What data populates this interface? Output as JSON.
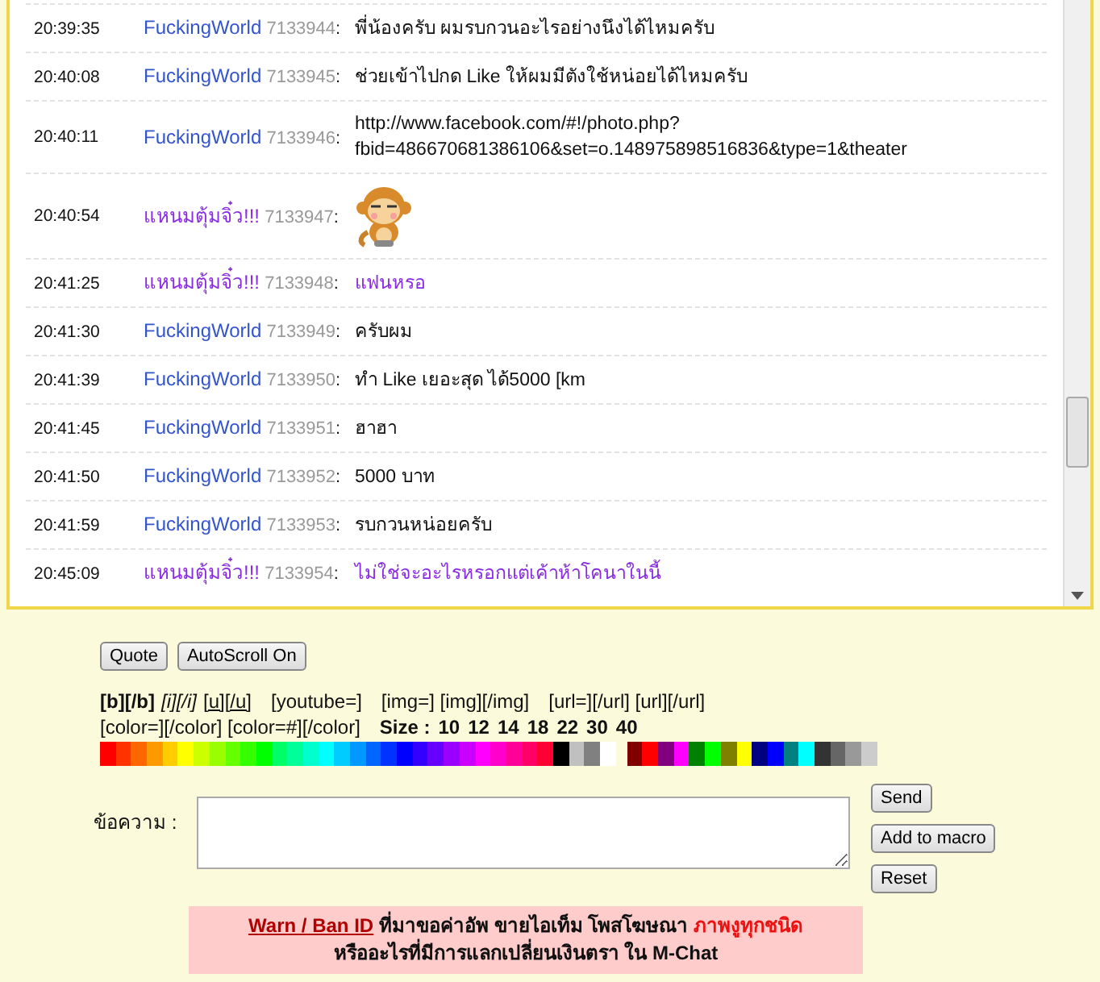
{
  "messages": [
    {
      "time": "20:39:35",
      "user": "FuckingWorld",
      "color": "#3355cc",
      "id": "7133944",
      "kind": "text",
      "text": "พี่น้องครับ ผมรบกวนอะไรอย่างนึงได้ไหมครับ",
      "colored_text": false
    },
    {
      "time": "20:40:08",
      "user": "FuckingWorld",
      "color": "#3355cc",
      "id": "7133945",
      "kind": "text",
      "text": "ช่วยเข้าไปกด Like ให้ผมมีตังใช้หน่อยได้ไหมครับ",
      "colored_text": false
    },
    {
      "time": "20:40:11",
      "user": "FuckingWorld",
      "color": "#3355cc",
      "id": "7133946",
      "kind": "text",
      "text": "http://www.facebook.com/#!/photo.php?\nfbid=486670681386106&set=o.148975898516836&type=1&theater",
      "colored_text": false
    },
    {
      "time": "20:40:54",
      "user": "แหนมตุ้มจิ๋ว!!!",
      "color": "#8a2be2",
      "id": "7133947",
      "kind": "sticker"
    },
    {
      "time": "20:41:25",
      "user": "แหนมตุ้มจิ๋ว!!!",
      "color": "#8a2be2",
      "id": "7133948",
      "kind": "text",
      "text": "แฟนหรอ",
      "colored_text": true
    },
    {
      "time": "20:41:30",
      "user": "FuckingWorld",
      "color": "#3355cc",
      "id": "7133949",
      "kind": "text",
      "text": "ครับผม",
      "colored_text": false
    },
    {
      "time": "20:41:39",
      "user": "FuckingWorld",
      "color": "#3355cc",
      "id": "7133950",
      "kind": "text",
      "text": "ทำ Like เยอะสุด ได้5000 [km",
      "colored_text": false
    },
    {
      "time": "20:41:45",
      "user": "FuckingWorld",
      "color": "#3355cc",
      "id": "7133951",
      "kind": "text",
      "text": "ฮาฮา",
      "colored_text": false
    },
    {
      "time": "20:41:50",
      "user": "FuckingWorld",
      "color": "#3355cc",
      "id": "7133952",
      "kind": "text",
      "text": "5000 บาท",
      "colored_text": false
    },
    {
      "time": "20:41:59",
      "user": "FuckingWorld",
      "color": "#3355cc",
      "id": "7133953",
      "kind": "text",
      "text": "รบกวนหน่อยครับ",
      "colored_text": false
    },
    {
      "time": "20:45:09",
      "user": "แหนมตุ้มจิ๋ว!!!",
      "color": "#8a2be2",
      "id": "7133954",
      "kind": "text",
      "text": "ไม่ใช่จะอะไรหรอกแต่เค้าห้าโคนาในนี้",
      "colored_text": true
    }
  ],
  "separator": ":",
  "top_buttons": [
    "Quote",
    "AutoScroll On"
  ],
  "bbcode_lines": [
    [
      {
        "text": "[b][/b]",
        "kind": "bold"
      },
      {
        "text": "[i][/i]",
        "kind": "italic"
      },
      {
        "text": "[u][/u]",
        "kind": "underline"
      },
      {
        "text": "[youtube=]",
        "kind": "plain"
      },
      {
        "text": "[img=] [img][/img]",
        "kind": "plain"
      },
      {
        "text": "[url=][/url] [url][/url]",
        "kind": "plain"
      }
    ],
    [
      {
        "text": "[color=][/color] [color=#][/color]",
        "kind": "plain"
      },
      {
        "text": "Size :",
        "kind": "bold"
      },
      {
        "text": "10",
        "kind": "bold"
      },
      {
        "text": "12",
        "kind": "bold"
      },
      {
        "text": "14",
        "kind": "bold"
      },
      {
        "text": "18",
        "kind": "bold"
      },
      {
        "text": "22",
        "kind": "bold"
      },
      {
        "text": "30",
        "kind": "bold"
      },
      {
        "text": "40",
        "kind": "bold"
      }
    ]
  ],
  "palette": [
    [
      {
        "color": "#ff0000"
      },
      {
        "color": "#ff3300"
      },
      {
        "color": "#ff6600"
      },
      {
        "color": "#ff9900"
      },
      {
        "color": "#ffcc00"
      },
      {
        "color": "#ffff00"
      },
      {
        "color": "#ccff00"
      },
      {
        "color": "#99ff00"
      },
      {
        "color": "#66ff00"
      },
      {
        "color": "#33ff00"
      },
      {
        "color": "#00ff00"
      },
      {
        "color": "#00ff66"
      },
      {
        "color": "#00ff99"
      },
      {
        "color": "#00ffcc"
      },
      {
        "color": "#00ffff"
      },
      {
        "color": "#00ccff"
      },
      {
        "color": "#0099ff"
      },
      {
        "color": "#0066ff"
      },
      {
        "color": "#0033ff"
      },
      {
        "color": "#0000ff"
      },
      {
        "color": "#3300ff"
      },
      {
        "color": "#6600ff"
      },
      {
        "color": "#9900ff"
      },
      {
        "color": "#cc00ff"
      },
      {
        "color": "#ff00ff"
      },
      {
        "color": "#ff00cc"
      },
      {
        "color": "#ff0099"
      },
      {
        "color": "#ff0066"
      },
      {
        "color": "#ff0033"
      },
      {
        "color": "#000000"
      },
      {
        "color": "#c0c0c0"
      },
      {
        "color": "#808080"
      },
      {
        "color": "#ffffff"
      }
    ],
    [
      {
        "color": "#800000"
      },
      {
        "color": "#ff0000"
      },
      {
        "color": "#800080"
      },
      {
        "color": "#ff00ff"
      },
      {
        "color": "#008000"
      },
      {
        "color": "#00ff00"
      },
      {
        "color": "#808000"
      },
      {
        "color": "#ffff00"
      },
      {
        "color": "#000080"
      },
      {
        "color": "#0000ff"
      },
      {
        "color": "#008080"
      },
      {
        "color": "#00ffff"
      },
      {
        "color": "#333333"
      },
      {
        "color": "#666666"
      },
      {
        "color": "#999999"
      },
      {
        "color": "#cccccc"
      }
    ]
  ],
  "message_label": "ข้อความ :",
  "side_buttons": [
    "Send",
    "Add to macro",
    "Reset"
  ],
  "warning": [
    [
      {
        "text": "Warn / Ban ID",
        "kind": "link"
      },
      {
        "text": "ที่มาขอค่าอัพ ขายไอเท็ม โพสโฆษณา",
        "kind": "plain"
      },
      {
        "text": "ภาพงูทุกชนิด",
        "kind": "alert"
      }
    ],
    [
      {
        "text": "หรืออะไรที่มีการแลกเปลี่ยนเงินตรา ใน M-Chat",
        "kind": "plain"
      }
    ]
  ]
}
